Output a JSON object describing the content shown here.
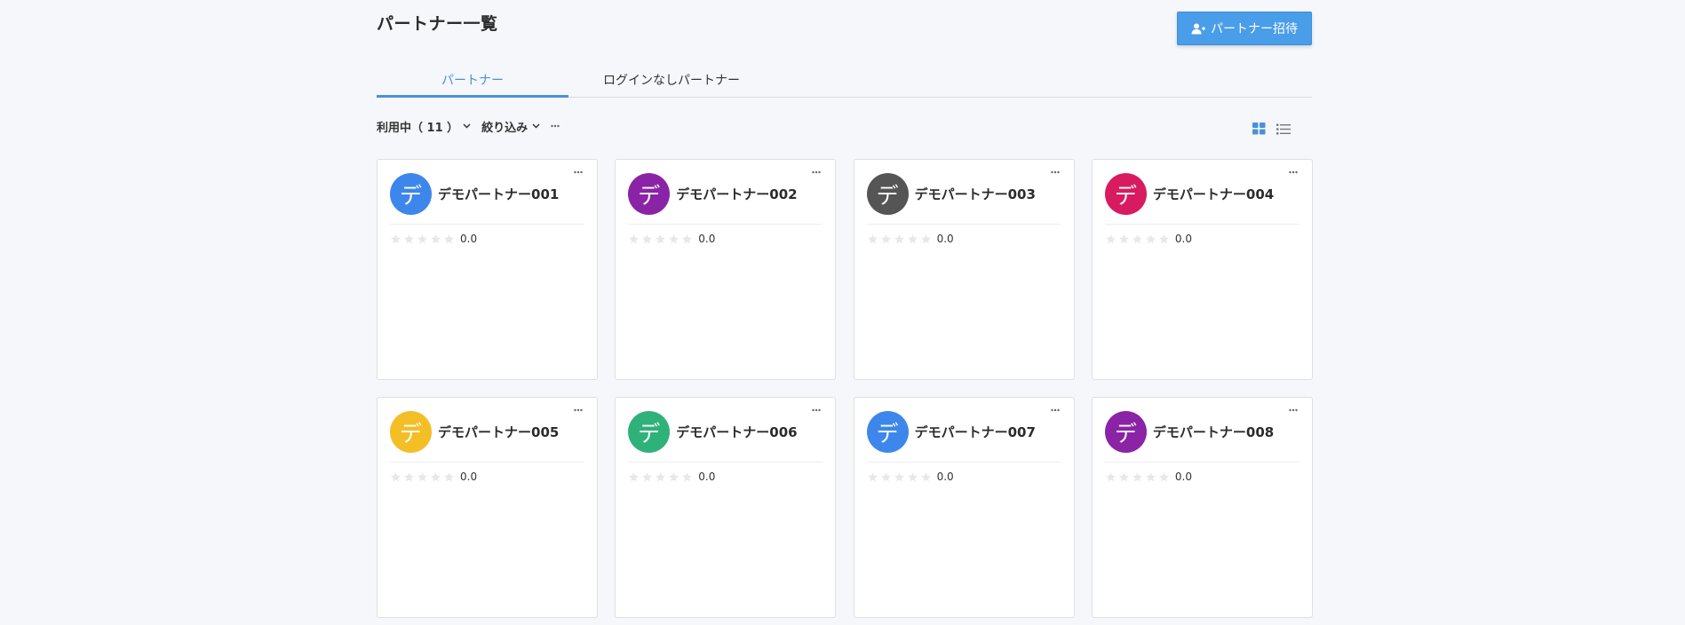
{
  "page": {
    "title": "パートナー一覧",
    "invite_label": "パートナー招待"
  },
  "tabs": [
    {
      "label": "パートナー",
      "active": true
    },
    {
      "label": "ログインなしパートナー",
      "active": false
    }
  ],
  "filters": {
    "status_label": "利用中（ 11 ）",
    "filter_label": "絞り込み"
  },
  "icons": {
    "invite": "add-user-icon",
    "grid_view": "grid-view-icon",
    "list_view": "list-view-icon",
    "more": "ellipsis-icon",
    "chevron": "chevron-down-icon",
    "star": "star-icon"
  },
  "accent_color": "#4a90d9",
  "partners": [
    {
      "initial": "デ",
      "name": "デモパートナー001",
      "color": "#3d87ec",
      "rating": "0.0",
      "stars": 0
    },
    {
      "initial": "デ",
      "name": "デモパートナー002",
      "color": "#8b23a6",
      "rating": "0.0",
      "stars": 0
    },
    {
      "initial": "デ",
      "name": "デモパートナー003",
      "color": "#555555",
      "rating": "0.0",
      "stars": 0
    },
    {
      "initial": "デ",
      "name": "デモパートナー004",
      "color": "#d81b60",
      "rating": "0.0",
      "stars": 0
    },
    {
      "initial": "デ",
      "name": "デモパートナー005",
      "color": "#f4be27",
      "rating": "0.0",
      "stars": 0
    },
    {
      "initial": "デ",
      "name": "デモパートナー006",
      "color": "#2fb27a",
      "rating": "0.0",
      "stars": 0
    },
    {
      "initial": "デ",
      "name": "デモパートナー007",
      "color": "#3d87ec",
      "rating": "0.0",
      "stars": 0
    },
    {
      "initial": "デ",
      "name": "デモパートナー008",
      "color": "#8b23a6",
      "rating": "0.0",
      "stars": 0
    }
  ]
}
